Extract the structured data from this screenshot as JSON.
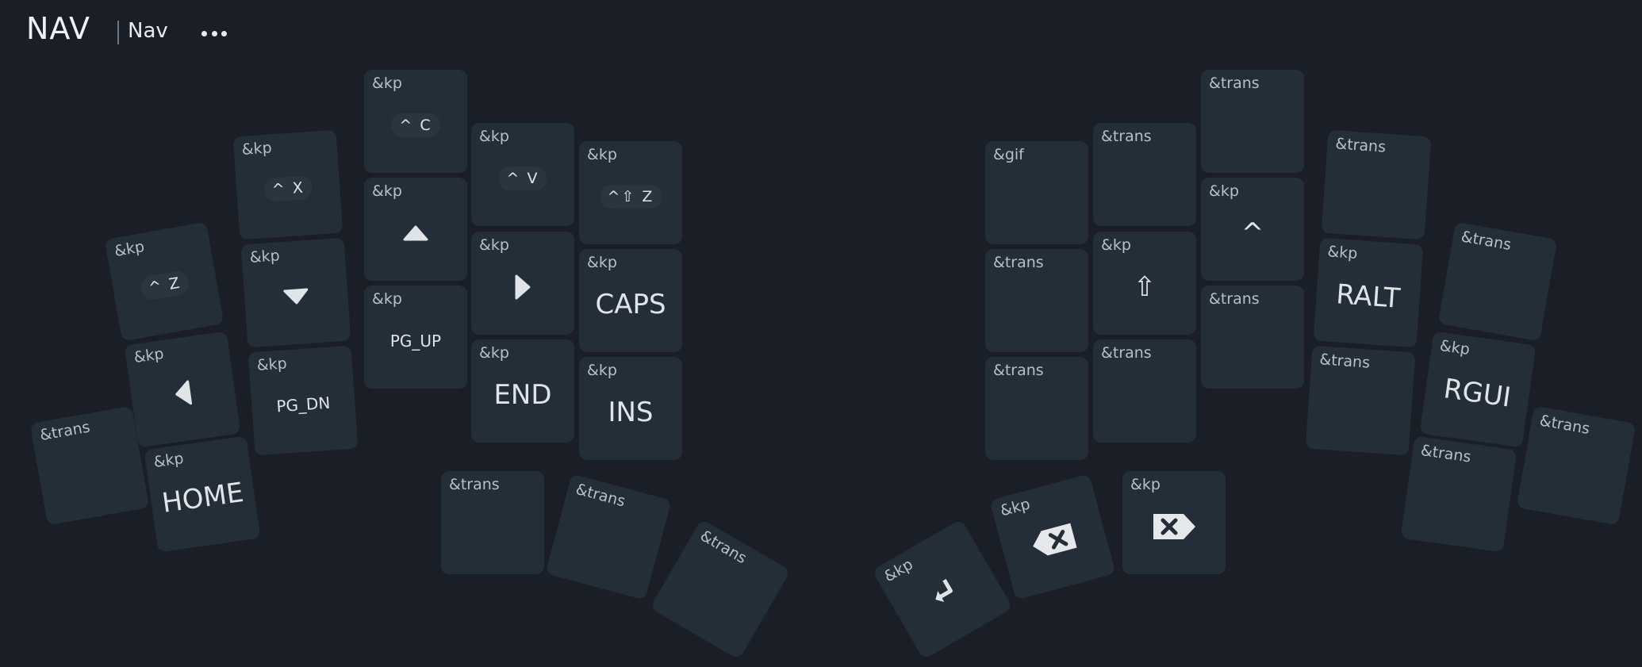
{
  "header": {
    "layer_title": "NAV",
    "layer_tab": "Nav",
    "more_icon": "ellipsis-icon"
  },
  "keys": [
    {
      "id": "l-c3-r0",
      "binding": "&kp",
      "legend": "^ C",
      "style": "chip"
    },
    {
      "id": "l-c2-r0",
      "binding": "&kp",
      "legend": "^ X",
      "style": "chip"
    },
    {
      "id": "l-c4-r0",
      "binding": "&kp",
      "legend": "^ V",
      "style": "chip"
    },
    {
      "id": "l-c5-r0",
      "binding": "&kp",
      "legend": "^⇧ Z",
      "style": "chip"
    },
    {
      "id": "l-c1-r0",
      "binding": "&kp",
      "legend": "^ Z",
      "style": "chip"
    },
    {
      "id": "l-c3-r1",
      "binding": "&kp",
      "legend": "",
      "style": "icon",
      "icon": "arrow-up-icon"
    },
    {
      "id": "l-c2-r1",
      "binding": "&kp",
      "legend": "",
      "style": "icon",
      "icon": "arrow-down-icon"
    },
    {
      "id": "l-c4-r1",
      "binding": "&kp",
      "legend": "",
      "style": "icon",
      "icon": "arrow-right-icon"
    },
    {
      "id": "l-c5-r1",
      "binding": "&kp",
      "legend": "CAPS",
      "style": "big"
    },
    {
      "id": "l-c1-r1",
      "binding": "&kp",
      "legend": "",
      "style": "icon",
      "icon": "arrow-left-icon"
    },
    {
      "id": "l-c3-r2",
      "binding": "&kp",
      "legend": "PG_UP",
      "style": "small"
    },
    {
      "id": "l-c2-r2",
      "binding": "&kp",
      "legend": "PG_DN",
      "style": "small"
    },
    {
      "id": "l-c4-r2",
      "binding": "&kp",
      "legend": "END",
      "style": "big"
    },
    {
      "id": "l-c5-r2",
      "binding": "&kp",
      "legend": "INS",
      "style": "big"
    },
    {
      "id": "l-c0-r2",
      "binding": "&trans",
      "legend": "",
      "style": "big"
    },
    {
      "id": "l-c1-r2",
      "binding": "&kp",
      "legend": "HOME",
      "style": "big"
    },
    {
      "id": "l-t0",
      "binding": "&trans",
      "legend": "",
      "style": "big"
    },
    {
      "id": "l-t1",
      "binding": "&trans",
      "legend": "",
      "style": "big"
    },
    {
      "id": "l-t2",
      "binding": "&trans",
      "legend": "",
      "style": "big"
    },
    {
      "id": "r-c0-r0",
      "binding": "&gif",
      "legend": "",
      "style": "big"
    },
    {
      "id": "r-c1-r0",
      "binding": "&trans",
      "legend": "",
      "style": "big"
    },
    {
      "id": "r-c2-r0",
      "binding": "&trans",
      "legend": "",
      "style": "big"
    },
    {
      "id": "r-c3-r0",
      "binding": "&trans",
      "legend": "",
      "style": "big"
    },
    {
      "id": "r-c2-r1",
      "binding": "&kp",
      "legend": "^",
      "style": "big"
    },
    {
      "id": "r-c0-r1",
      "binding": "&trans",
      "legend": "",
      "style": "big"
    },
    {
      "id": "r-c1-r1",
      "binding": "&kp",
      "legend": "⇧",
      "style": "big"
    },
    {
      "id": "r-c3-r1",
      "binding": "&kp",
      "legend": "RALT",
      "style": "big"
    },
    {
      "id": "r-c4-r1",
      "binding": "&trans",
      "legend": "",
      "style": "big"
    },
    {
      "id": "r-c2-r2",
      "binding": "&trans",
      "legend": "",
      "style": "big"
    },
    {
      "id": "r-c0-r2",
      "binding": "&trans",
      "legend": "",
      "style": "big"
    },
    {
      "id": "r-c1-r2",
      "binding": "&trans",
      "legend": "",
      "style": "big"
    },
    {
      "id": "r-c3-r2",
      "binding": "&trans",
      "legend": "",
      "style": "big"
    },
    {
      "id": "r-c4-r2",
      "binding": "&kp",
      "legend": "RGUI",
      "style": "big"
    },
    {
      "id": "r-c5-r2",
      "binding": "&trans",
      "legend": "",
      "style": "big"
    },
    {
      "id": "r-c4-r3",
      "binding": "&trans",
      "legend": "",
      "style": "big"
    },
    {
      "id": "r-t0",
      "binding": "&kp",
      "legend": "",
      "style": "icon",
      "icon": "return-icon"
    },
    {
      "id": "r-t1",
      "binding": "&kp",
      "legend": "",
      "style": "icon",
      "icon": "backspace-icon"
    },
    {
      "id": "r-t2",
      "binding": "&kp",
      "legend": "",
      "style": "icon",
      "icon": "delete-icon"
    }
  ]
}
